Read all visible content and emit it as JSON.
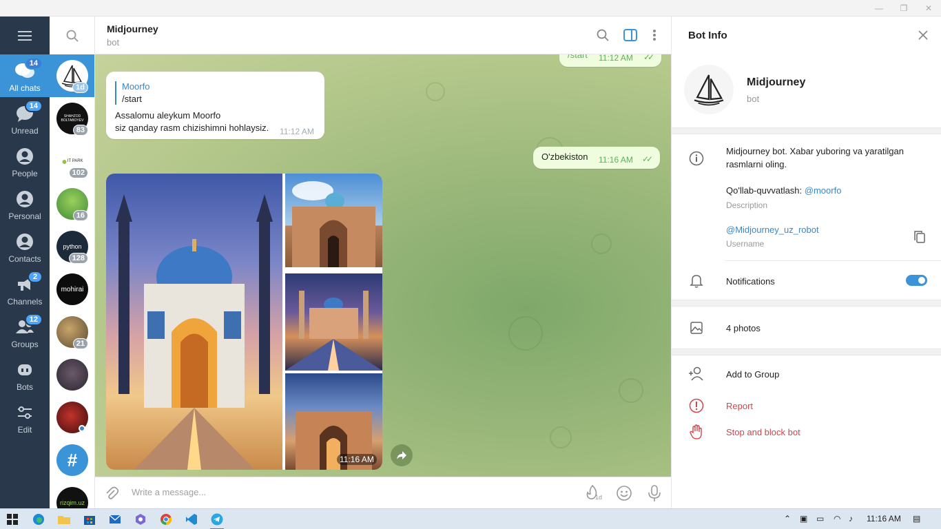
{
  "window": {
    "minimize": "—",
    "maximize": "❐",
    "close": "✕"
  },
  "folders": [
    {
      "label": "All chats",
      "badge": "14",
      "icon": "chats-icon"
    },
    {
      "label": "Unread",
      "badge": "14",
      "icon": "unread-icon"
    },
    {
      "label": "People",
      "badge": "",
      "icon": "person-icon"
    },
    {
      "label": "Personal",
      "badge": "",
      "icon": "person-icon"
    },
    {
      "label": "Contacts",
      "badge": "",
      "icon": "person-icon"
    },
    {
      "label": "Channels",
      "badge": "2",
      "icon": "megaphone-icon"
    },
    {
      "label": "Groups",
      "badge": "12",
      "icon": "group-icon"
    },
    {
      "label": "Bots",
      "badge": "",
      "icon": "bot-icon"
    },
    {
      "label": "Edit",
      "badge": "",
      "icon": "sliders-icon"
    }
  ],
  "chats": [
    {
      "badge": "1d",
      "text": ""
    },
    {
      "badge": "83",
      "text": "SHAHZOD BOLTABOYEV"
    },
    {
      "badge": "102",
      "text": "IT PARK"
    },
    {
      "badge": "16",
      "text": ""
    },
    {
      "badge": "128",
      "text": "python"
    },
    {
      "badge": "",
      "text": "mohirai"
    },
    {
      "badge": "21",
      "text": ""
    },
    {
      "badge": "",
      "text": ""
    },
    {
      "badge": "",
      "text": ""
    },
    {
      "badge": "",
      "text": "#"
    },
    {
      "badge": "",
      "text": "rizqim.uz"
    }
  ],
  "chat": {
    "title": "Midjourney",
    "subtitle": "bot",
    "prev_out": {
      "text": "/start",
      "time": "11:12 AM"
    },
    "reply_msg": {
      "quote_author": "Moorfo",
      "quote_text": "/start",
      "line1": "Assalomu aleykum Moorfo",
      "line2": "siz qanday rasm chizishimni hohlaysiz.",
      "time": "11:12 AM"
    },
    "out_msg": {
      "text": "O'zbekiston",
      "time": "11:16 AM"
    },
    "album_time": "11:16 AM",
    "composer_placeholder": "Write a message...",
    "timer_label": "1d"
  },
  "info": {
    "title": "Bot Info",
    "name": "Midjourney",
    "subtitle": "bot",
    "desc_line1": "Midjourney bot. Xabar yuboring va yaratilgan",
    "desc_line2": "rasmlarni oling.",
    "support_prefix": "Qo'llab-quvvatlash: ",
    "support_link": "@moorfo",
    "desc_label": "Description",
    "username": "@Midjourney_uz_robot",
    "username_label": "Username",
    "notifications": "Notifications",
    "notifications_on": true,
    "photos": "4 photos",
    "add_to_group": "Add to Group",
    "report": "Report",
    "stop_block": "Stop and block bot"
  },
  "taskbar": {
    "clock": "11:16 AM"
  },
  "colors": {
    "accent": "#3b93d8",
    "sidebar": "#29384a",
    "danger": "#d3444a",
    "link": "#3a87c8"
  }
}
